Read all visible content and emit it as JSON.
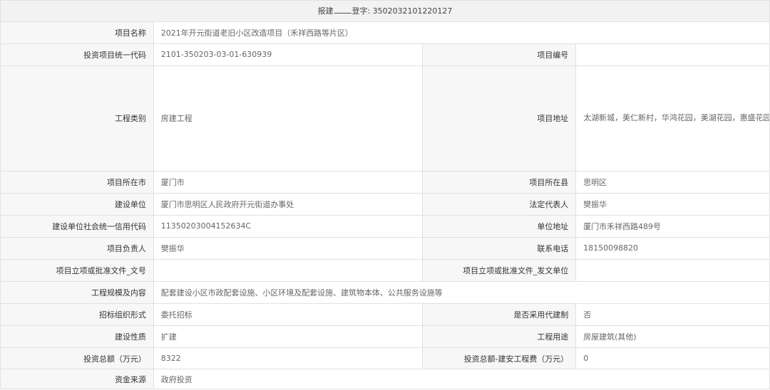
{
  "header": {
    "prefix": "报建",
    "label": "登字:",
    "number": "3502032101220127"
  },
  "rows": {
    "project_name_label": "项目名称",
    "project_name": "2021年开元街道老旧小区改造项目（禾祥西路等片区）",
    "invest_code_label": "投资项目统一代码",
    "invest_code": "2101-350203-03-01-630939",
    "project_no_label": "项目编号",
    "project_no": "",
    "project_type_label": "工程类别",
    "project_type": "房建工程",
    "project_addr_label": "项目地址",
    "project_addr": "太湖新城，美仁新村，华鸿花园，美湖花园，惠盛花园，光华大厦，嘉禾公寓，机场修建处宿舍，日报社宿舍，市质量技术监督局宿舍，家具厂宿舍，汇禾新城、海明苑，五州大厦，后滨路15等禾祥西路、后滨路",
    "city_label": "项目所在市",
    "city": "厦门市",
    "county_label": "项目所在县",
    "county": "思明区",
    "builder_label": "建设单位",
    "builder": "厦门市思明区人民政府开元街道办事处",
    "legal_rep_label": "法定代表人",
    "legal_rep": "樊振华",
    "credit_code_label": "建设单位社会统一信用代码",
    "credit_code": "11350203004152634C",
    "unit_addr_label": "单位地址",
    "unit_addr": "厦门市禾祥西路489号",
    "manager_label": "项目负责人",
    "manager": "樊振华",
    "phone_label": "联系电话",
    "phone": "18150098820",
    "approval_no_label": "项目立项或批准文件_文号",
    "approval_no": "",
    "approval_unit_label": "项目立项或批准文件_发文单位",
    "approval_unit": "",
    "scale_label": "工程规模及内容",
    "scale": "配套建设小区市政配套设施、小区环境及配套设施、建筑物本体、公共服务设施等",
    "bid_form_label": "招标组织形式",
    "bid_form": "委托招标",
    "agent_label": "是否采用代建制",
    "agent": "否",
    "nature_label": "建设性质",
    "nature": "扩建",
    "usage_label": "工程用途",
    "usage": "房屋建筑(其他)",
    "total_invest_label": "投资总额（万元）",
    "total_invest": "8322",
    "install_fee_label": "投资总额-建安工程费（万元）",
    "install_fee": "0",
    "fund_source_label": "资金来源",
    "fund_source": "政府投资"
  }
}
